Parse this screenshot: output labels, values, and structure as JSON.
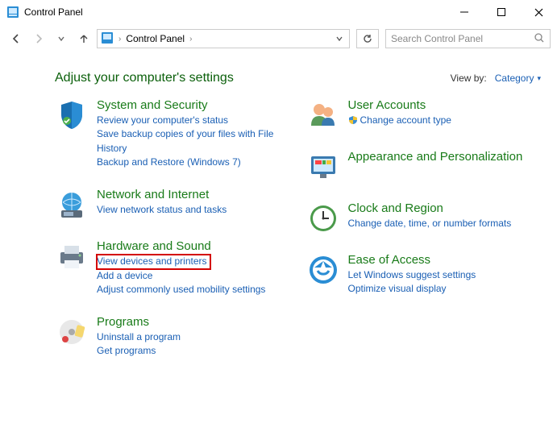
{
  "window": {
    "title": "Control Panel"
  },
  "breadcrumb": {
    "root": "Control Panel"
  },
  "search": {
    "placeholder": "Search Control Panel"
  },
  "header": {
    "title": "Adjust your computer's settings",
    "viewby_label": "View by:",
    "viewby_value": "Category"
  },
  "left": {
    "system": {
      "title": "System and Security",
      "l1": "Review your computer's status",
      "l2": "Save backup copies of your files with File History",
      "l3": "Backup and Restore (Windows 7)"
    },
    "network": {
      "title": "Network and Internet",
      "l1": "View network status and tasks"
    },
    "hardware": {
      "title": "Hardware and Sound",
      "l1": "View devices and printers",
      "l2": "Add a device",
      "l3": "Adjust commonly used mobility settings"
    },
    "programs": {
      "title": "Programs",
      "l1": "Uninstall a program",
      "l2": "Get programs"
    }
  },
  "right": {
    "users": {
      "title": "User Accounts",
      "l1": "Change account type"
    },
    "appearance": {
      "title": "Appearance and Personalization"
    },
    "clock": {
      "title": "Clock and Region",
      "l1": "Change date, time, or number formats"
    },
    "ease": {
      "title": "Ease of Access",
      "l1": "Let Windows suggest settings",
      "l2": "Optimize visual display"
    }
  }
}
